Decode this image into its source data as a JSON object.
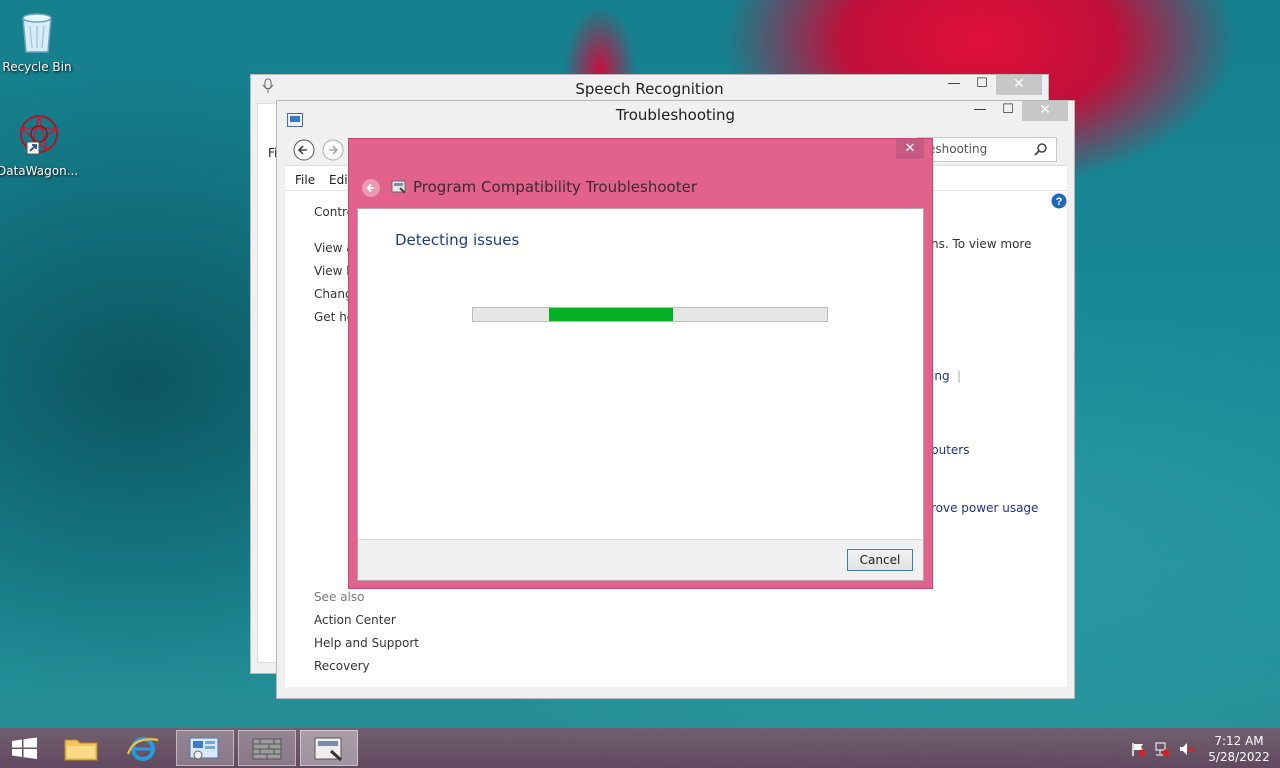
{
  "desktop": {
    "icons": [
      {
        "label": "Recycle Bin"
      },
      {
        "label": "DataWagon..."
      }
    ]
  },
  "speech_window": {
    "title": "Speech Recognition",
    "partial_menu": "Fi"
  },
  "troubleshooting_window": {
    "title": "Troubleshooting",
    "search_value": "eshooting",
    "menu": [
      "File",
      "Edit"
    ],
    "breadcrumb": "Contro",
    "left_links": [
      "View a",
      "View h",
      "Chang",
      "Get he"
    ],
    "right_text": "ns. To view more",
    "right_links": [
      "ing",
      "puters",
      "rove power usage"
    ],
    "see_also_label": "See also",
    "see_also": [
      "Action Center",
      "Help and Support",
      "Recovery"
    ]
  },
  "dialog": {
    "title": "Program Compatibility Troubleshooter",
    "heading": "Detecting issues",
    "progress": {
      "value": 0.35,
      "color": "#06b025"
    },
    "cancel_label": "Cancel",
    "accent_color": "#e2628c"
  },
  "taskbar": {
    "time": "7:12 AM",
    "date": "5/28/2022",
    "items": [
      "start",
      "file-explorer",
      "internet-explorer",
      "control-panel",
      "firewall",
      "troubleshooter"
    ]
  }
}
